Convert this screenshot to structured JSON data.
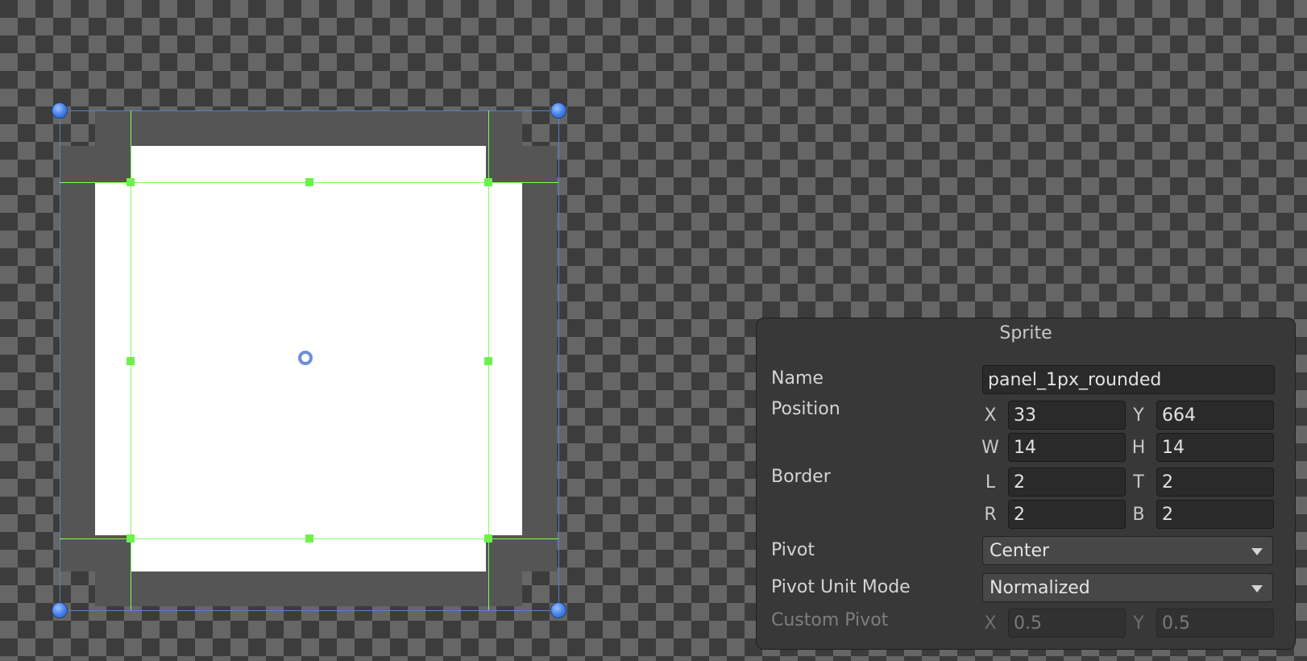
{
  "panel": {
    "title": "Sprite",
    "name_label": "Name",
    "name_value": "panel_1px_rounded",
    "position_label": "Position",
    "position": {
      "x_axis": "X",
      "x": "33",
      "y_axis": "Y",
      "y": "664",
      "w_axis": "W",
      "w": "14",
      "h_axis": "H",
      "h": "14"
    },
    "border_label": "Border",
    "border": {
      "l_axis": "L",
      "l": "2",
      "t_axis": "T",
      "t": "2",
      "r_axis": "R",
      "r": "2",
      "b_axis": "B",
      "b": "2"
    },
    "pivot_label": "Pivot",
    "pivot_value": "Center",
    "pivot_unit_mode_label": "Pivot Unit Mode",
    "pivot_unit_mode_value": "Normalized",
    "custom_pivot_label": "Custom Pivot",
    "custom_pivot": {
      "x_axis": "X",
      "x": "0.5",
      "y_axis": "Y",
      "y": "0.5"
    }
  },
  "colors": {
    "selection_outline": "#5a7fc9",
    "border_guides": "#7dff5a",
    "sprite_border": "#555555",
    "sprite_fill": "#ffffff"
  },
  "icons": {
    "corner_handle": "blue-circle-handle",
    "border_handle": "green-square-handle",
    "pivot": "pivot-ring"
  }
}
